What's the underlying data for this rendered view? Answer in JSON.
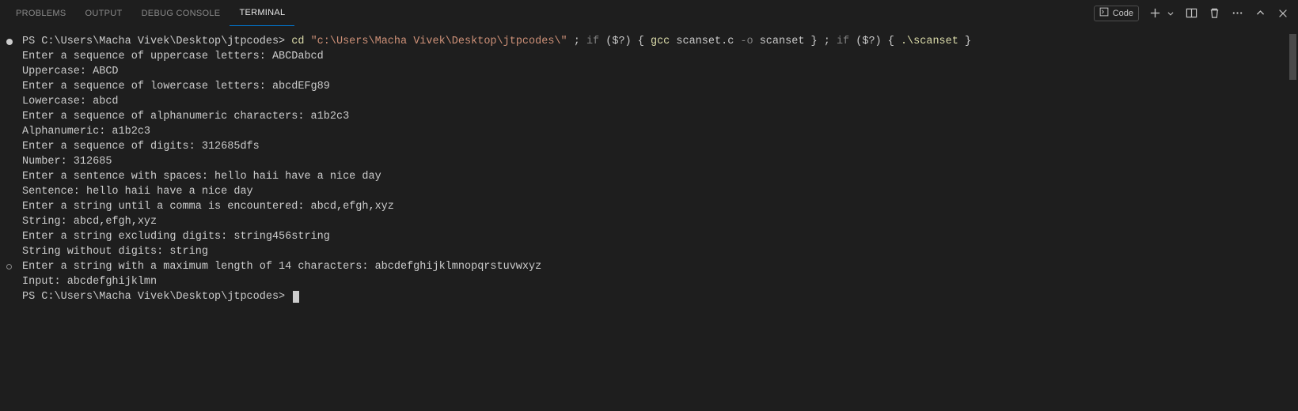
{
  "tabs": {
    "problems": "PROBLEMS",
    "output": "OUTPUT",
    "debug_console": "DEBUG CONSOLE",
    "terminal": "TERMINAL"
  },
  "toolbar": {
    "code_label": "Code"
  },
  "prompt_path": "PS C:\\Users\\Macha Vivek\\Desktop\\jtpcodes> ",
  "cmd": {
    "cd": "cd",
    "path": "\"c:\\Users\\Macha Vivek\\Desktop\\jtpcodes\\\"",
    "sep1": " ; ",
    "if1": "if",
    "cond": " ($?) { ",
    "gcc": "gcc",
    "src": " scanset.c ",
    "flag": "-o",
    "out": " scanset } ",
    "sep2": "; ",
    "if2": "if",
    "cond2": " ($?) { ",
    "run": ".\\scanset",
    "end": " }"
  },
  "lines": {
    "l1": "Enter a sequence of uppercase letters: ABCDabcd",
    "l2": "Uppercase: ABCD",
    "l3": "Enter a sequence of lowercase letters: abcdEFg89",
    "l4": "Lowercase: abcd",
    "l5": "Enter a sequence of alphanumeric characters: a1b2c3",
    "l6": "Alphanumeric: a1b2c3",
    "l7": "Enter a sequence of digits: 312685dfs",
    "l8": "Number: 312685",
    "l9": "Enter a sentence with spaces: hello haii have a nice day",
    "l10": "Sentence: hello haii have a nice day",
    "l11": "Enter a string until a comma is encountered: abcd,efgh,xyz",
    "l12": "String: abcd,efgh,xyz",
    "l13": "Enter a string excluding digits: string456string",
    "l14": "String without digits: string",
    "l15": "Enter a string with a maximum length of 14 characters: abcdefghijklmnopqrstuvwxyz",
    "l16": "Input: abcdefghijklmn"
  }
}
